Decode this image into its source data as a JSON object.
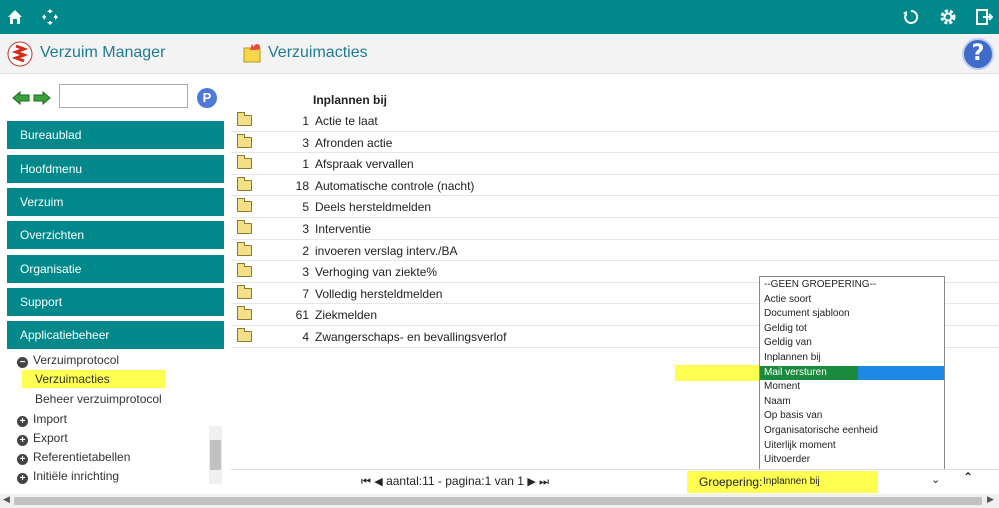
{
  "topbar": {
    "left_icons": [
      "home-icon",
      "fullscreen-icon"
    ],
    "right_icons": [
      "refresh-icon",
      "settings-icon",
      "logout-icon"
    ]
  },
  "app": {
    "title": "Verzuim Manager",
    "page_title": "Verzuimacties",
    "help_label": "?"
  },
  "sidebar": {
    "search_placeholder": "",
    "search_button": "P",
    "menu": [
      {
        "label": "Bureaublad"
      },
      {
        "label": "Hoofdmenu"
      },
      {
        "label": "Verzuim"
      },
      {
        "label": "Overzichten"
      },
      {
        "label": "Organisatie"
      },
      {
        "label": "Support"
      },
      {
        "label": "Applicatiebeheer"
      }
    ],
    "tree": [
      {
        "label": "Verzuimprotocol",
        "sign": "−",
        "level": 0,
        "highlight": false
      },
      {
        "label": "Verzuimacties",
        "sign": "",
        "level": 1,
        "highlight": true
      },
      {
        "label": "Beheer verzuimprotocol",
        "sign": "",
        "level": 1,
        "highlight": false
      },
      {
        "label": "Import",
        "sign": "+",
        "level": 0,
        "highlight": false
      },
      {
        "label": "Export",
        "sign": "+",
        "level": 0,
        "highlight": false
      },
      {
        "label": "Referentietabellen",
        "sign": "+",
        "level": 0,
        "highlight": false
      },
      {
        "label": "Initiële inrichting",
        "sign": "+",
        "level": 0,
        "highlight": false
      }
    ]
  },
  "main": {
    "column_header": "Inplannen bij",
    "rows": [
      {
        "count": "1",
        "label": "Actie te laat"
      },
      {
        "count": "3",
        "label": "Afronden actie"
      },
      {
        "count": "1",
        "label": "Afspraak vervallen"
      },
      {
        "count": "18",
        "label": "Automatische controle (nacht)"
      },
      {
        "count": "5",
        "label": "Deels hersteldmelden"
      },
      {
        "count": "3",
        "label": "Interventie"
      },
      {
        "count": "2",
        "label": "invoeren verslag interv./BA"
      },
      {
        "count": "3",
        "label": "Verhoging van ziekte%"
      },
      {
        "count": "7",
        "label": "Volledig hersteldmelden"
      },
      {
        "count": "61",
        "label": "Ziekmelden"
      },
      {
        "count": "4",
        "label": "Zwangerschaps- en bevallingsverlof"
      }
    ]
  },
  "dropdown": {
    "options": [
      "--GEEN GROEPERING--",
      "Actie soort",
      "Document sjabloon",
      "Geldig tot",
      "Geldig van",
      "Inplannen bij",
      "Mail versturen",
      "Moment",
      "Naam",
      "Op basis van",
      "Organisatorische eenheid",
      "Uiterlijk moment",
      "Uitvoerder"
    ],
    "selected_index": 6
  },
  "footer": {
    "first_icon": "⏮",
    "prev_icon": "◀",
    "count_text": "aantal:11",
    "separator": "-",
    "page_text": "pagina:1 van 1",
    "next_icon": "▶",
    "last_icon": "⏭",
    "grouping_label": "Groepering:",
    "grouping_value": "Inplannen bij",
    "chevron": "⌄",
    "collapse": "⌃"
  },
  "colors": {
    "teal": "#00888b",
    "highlight": "#ffff52",
    "selected_blue": "#1e88e5",
    "selected_green": "#1a8a3e"
  }
}
